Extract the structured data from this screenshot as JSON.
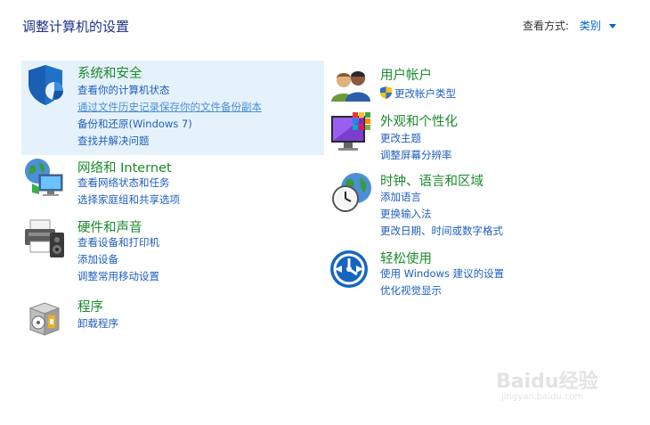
{
  "header": {
    "title": "调整计算机的设置",
    "view_by_label": "查看方式:",
    "view_by_value": "类别"
  },
  "categories": [
    {
      "title": "系统和安全",
      "icon": "shield-icon",
      "links": [
        "查看你的计算机状态",
        "通过文件历史记录保存你的文件备份副本",
        "备份和还原(Windows 7)",
        "查找并解决问题"
      ]
    },
    {
      "title": "网络和 Internet",
      "icon": "network-globe-icon",
      "links": [
        "查看网络状态和任务",
        "选择家庭组和共享选项"
      ]
    },
    {
      "title": "硬件和声音",
      "icon": "printer-speaker-icon",
      "links": [
        "查看设备和打印机",
        "添加设备",
        "调整常用移动设置"
      ]
    },
    {
      "title": "程序",
      "icon": "programs-box-icon",
      "links": [
        "卸载程序"
      ]
    },
    {
      "title": "用户帐户",
      "icon": "users-icon",
      "links": [
        "更改帐户类型"
      ]
    },
    {
      "title": "外观和个性化",
      "icon": "monitor-colors-icon",
      "links": [
        "更改主题",
        "调整屏幕分辨率"
      ]
    },
    {
      "title": "时钟、语言和区域",
      "icon": "clock-globe-icon",
      "links": [
        "添加语言",
        "更换输入法",
        "更改日期、时间或数字格式"
      ]
    },
    {
      "title": "轻松使用",
      "icon": "ease-of-access-icon",
      "links": [
        "使用 Windows 建议的设置",
        "优化视觉显示"
      ]
    }
  ],
  "watermark": {
    "text": "Baidu经验",
    "url": "jingyan.baidu.com"
  }
}
